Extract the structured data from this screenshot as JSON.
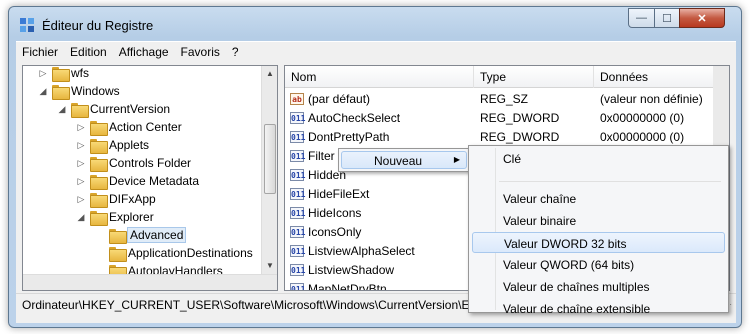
{
  "window": {
    "title": "Éditeur du Registre"
  },
  "controls": {
    "minimize": "—",
    "maximize": "☐",
    "close": "✕"
  },
  "menubar": [
    "Fichier",
    "Edition",
    "Affichage",
    "Favoris",
    "?"
  ],
  "tree": [
    {
      "label": "wfs",
      "indent": 0,
      "expander": "▷"
    },
    {
      "label": "Windows",
      "indent": 0,
      "expander": "◢"
    },
    {
      "label": "CurrentVersion",
      "indent": 1,
      "expander": "◢"
    },
    {
      "label": "Action Center",
      "indent": 2,
      "expander": "▷"
    },
    {
      "label": "Applets",
      "indent": 2,
      "expander": "▷"
    },
    {
      "label": "Controls Folder",
      "indent": 2,
      "expander": "▷"
    },
    {
      "label": "Device Metadata",
      "indent": 2,
      "expander": "▷"
    },
    {
      "label": "DIFxApp",
      "indent": 2,
      "expander": "▷"
    },
    {
      "label": "Explorer",
      "indent": 2,
      "expander": "◢"
    },
    {
      "label": "Advanced",
      "indent": 3,
      "expander": "",
      "selected": true
    },
    {
      "label": "ApplicationDestinations",
      "indent": 3,
      "expander": ""
    },
    {
      "label": "AutoplayHandlers",
      "indent": 3,
      "expander": ""
    }
  ],
  "list": {
    "columns": [
      "Nom",
      "Type",
      "Données"
    ],
    "rows": [
      {
        "icon": "ab",
        "name": "(par défaut)",
        "type": "REG_SZ",
        "data": "(valeur non définie)"
      },
      {
        "icon": "bin",
        "name": "AutoCheckSelect",
        "type": "REG_DWORD",
        "data": "0x00000000 (0)"
      },
      {
        "icon": "bin",
        "name": "DontPrettyPath",
        "type": "REG_DWORD",
        "data": "0x00000000 (0)"
      },
      {
        "icon": "bin",
        "name": "Filter",
        "type": "",
        "data": ""
      },
      {
        "icon": "bin",
        "name": "Hidden",
        "type": "",
        "data": ""
      },
      {
        "icon": "bin",
        "name": "HideFileExt",
        "type": "",
        "data": ""
      },
      {
        "icon": "bin",
        "name": "HideIcons",
        "type": "",
        "data": ""
      },
      {
        "icon": "bin",
        "name": "IconsOnly",
        "type": "",
        "data": ""
      },
      {
        "icon": "bin",
        "name": "ListviewAlphaSelect",
        "type": "",
        "data": ""
      },
      {
        "icon": "bin",
        "name": "ListviewShadow",
        "type": "",
        "data": ""
      },
      {
        "icon": "bin",
        "name": "MapNetDrvBtn",
        "type": "",
        "data": ""
      }
    ]
  },
  "context_menu": {
    "item": "Nouveau"
  },
  "submenu": {
    "items": [
      "Clé",
      "Valeur chaîne",
      "Valeur binaire",
      "Valeur DWORD 32 bits",
      "Valeur QWORD (64 bits)",
      "Valeur de chaînes multiples",
      "Valeur de chaîne extensible"
    ],
    "highlighted": "Valeur DWORD 32 bits"
  },
  "statusbar": {
    "path": "Ordinateur\\HKEY_CURRENT_USER\\Software\\Microsoft\\Windows\\CurrentVersion\\Explorer\\Advanced"
  }
}
